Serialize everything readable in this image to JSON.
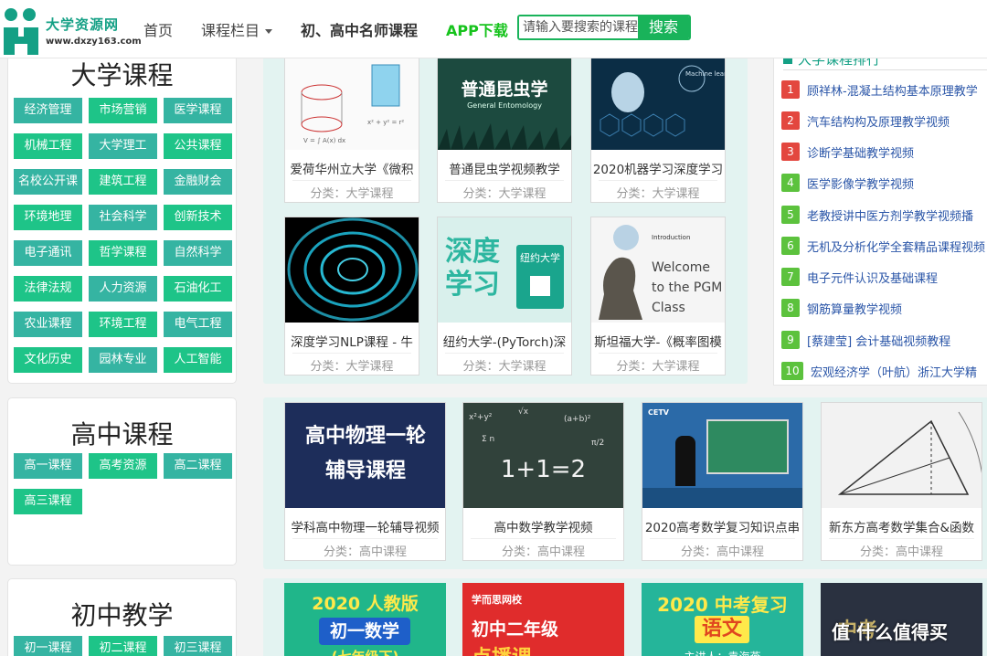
{
  "header": {
    "logo_title": "大学资源网",
    "logo_url": "www.dxzy163.com",
    "nav": [
      "首页",
      "课程栏目",
      "初、高中名师课程",
      "APP下载"
    ],
    "search_placeholder": "请输入要搜索的课程",
    "search_button": "搜索"
  },
  "categories": [
    {
      "title": "大学课程",
      "tags": [
        "经济管理",
        "市场营销",
        "医学课程",
        "机械工程",
        "大学理工",
        "公共课程",
        "名校公开课",
        "建筑工程",
        "金融财会",
        "环境地理",
        "社会科学",
        "创新技术",
        "电子通讯",
        "哲学课程",
        "自然科学",
        "法律法规",
        "人力资源",
        "石油化工",
        "农业课程",
        "环境工程",
        "电气工程",
        "文化历史",
        "园林专业",
        "人工智能"
      ]
    },
    {
      "title": "高中课程",
      "tags": [
        "高一课程",
        "高考资源",
        "高二课程",
        "高三课程"
      ]
    },
    {
      "title": "初中教学",
      "tags": [
        "初一课程",
        "初二课程",
        "初三课程"
      ]
    }
  ],
  "university_cards": [
    {
      "title": "爱荷华州立大学《微积",
      "category": "分类：大学课程",
      "thumb_text": ""
    },
    {
      "title": "普通昆虫学视频教学",
      "category": "分类：大学课程",
      "thumb_text": "普通昆虫学",
      "thumb_sub": "General Entomology"
    },
    {
      "title": "2020机器学习深度学习",
      "category": "分类：大学课程",
      "thumb_text": "Machine learning"
    },
    {
      "title": "深度学习NLP课程 - 牛",
      "category": "分类：大学课程",
      "thumb_text": ""
    },
    {
      "title": "纽约大学-(PyTorch)深",
      "category": "分类：大学课程",
      "thumb_text": "深度学习",
      "thumb_sub": "纽约大学"
    },
    {
      "title": "斯坦福大学-《概率图模",
      "category": "分类：大学课程",
      "thumb_text": "Welcome to the PGM Class",
      "thumb_sub": "Introduction"
    }
  ],
  "highschool_cards": [
    {
      "title": "学科高中物理一轮辅导视频",
      "category": "分类：高中课程",
      "thumb_text": "高中物理一轮辅导课程"
    },
    {
      "title": "高中数学教学视频",
      "category": "分类：高中课程",
      "thumb_text": "1+1=2"
    },
    {
      "title": "2020高考数学复习知识点串",
      "category": "分类：高中课程",
      "thumb_text": "CETV"
    },
    {
      "title": "新东方高考数学集合&函数",
      "category": "分类：高中课程",
      "thumb_text": ""
    }
  ],
  "middle_cards": [
    {
      "thumb_text": "2020 人教版",
      "thumb_sub": "初一数学",
      "thumb_sub2": "(七年级下)"
    },
    {
      "thumb_text": "学而思网校",
      "thumb_sub": "初中二年级",
      "thumb_sub2": "点播课"
    },
    {
      "thumb_text": "2020 中考复习",
      "thumb_sub": "语文",
      "thumb_sub2": "主讲人：袁海燕"
    },
    {
      "thumb_text": "中考",
      "thumb_sub": "",
      "thumb_sub2": ""
    }
  ],
  "ranking": {
    "title": "大学课程排行",
    "items": [
      {
        "num": "1",
        "text": "顾祥林-混凝土结构基本原理教学"
      },
      {
        "num": "2",
        "text": "汽车结构构及原理教学视频"
      },
      {
        "num": "3",
        "text": "诊断学基础教学视频"
      },
      {
        "num": "4",
        "text": "医学影像学教学视频"
      },
      {
        "num": "5",
        "text": "老教授讲中医方剂学教学视频播"
      },
      {
        "num": "6",
        "text": "无机及分析化学全套精品课程视频"
      },
      {
        "num": "7",
        "text": "电子元件认识及基础课程"
      },
      {
        "num": "8",
        "text": "钢筋算量教学视频"
      },
      {
        "num": "9",
        "text": "[蔡建莹] 会计基础视频教程"
      },
      {
        "num": "10",
        "text": "宏观经济学（叶航）浙江大学精"
      }
    ]
  },
  "watermark": "值 什么值得买",
  "colors": {
    "brand": "#14a085",
    "search_green": "#19b35a",
    "app_green": "#16c31c",
    "tag_teal": "#35b4a2",
    "tag_green": "#1ec488",
    "rank_red": "#e3473f",
    "rank_green": "#5cc23d"
  }
}
